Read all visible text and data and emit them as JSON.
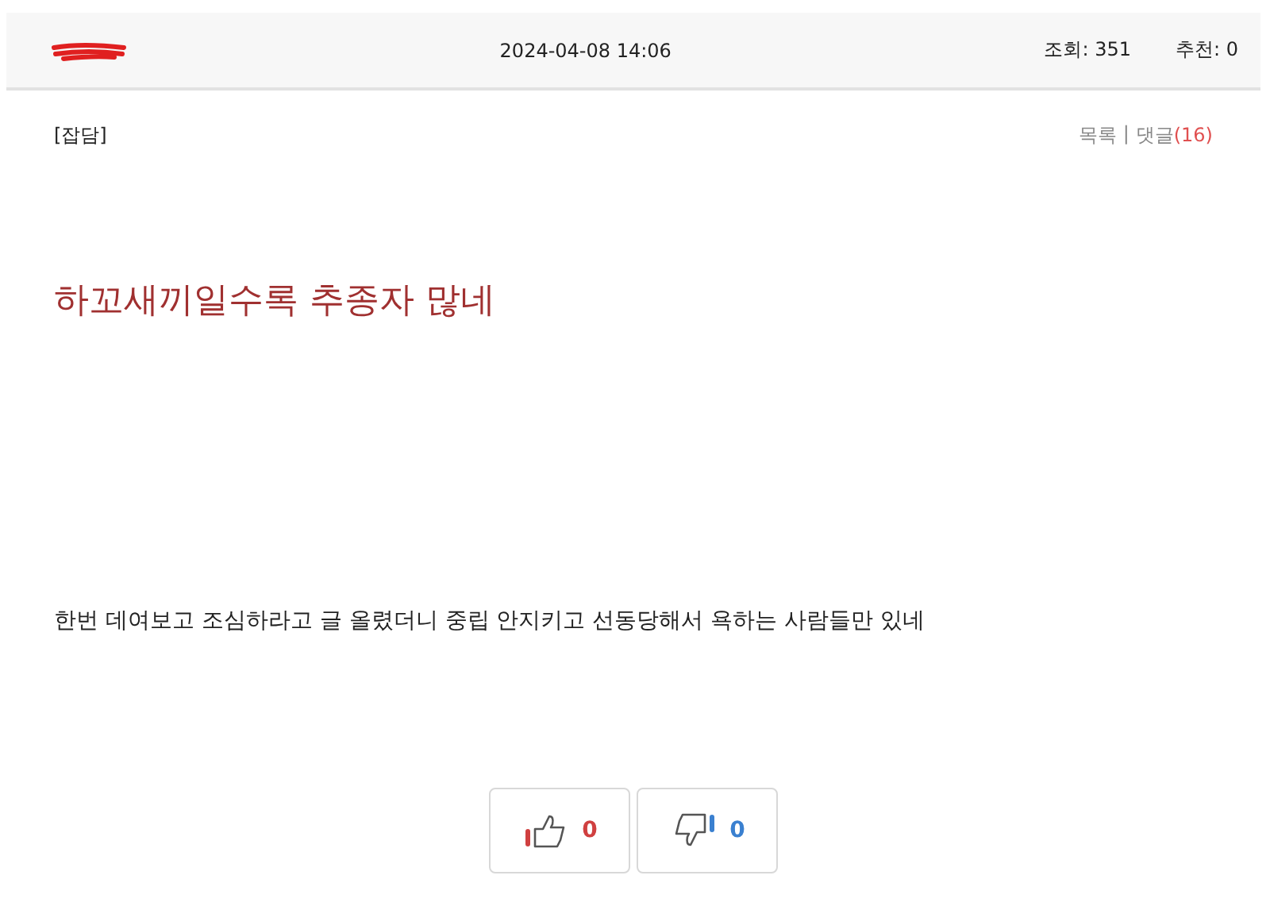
{
  "header": {
    "date": "2024-04-08 14:06",
    "views": "조회: 351",
    "recommends": "추천: 0"
  },
  "category": "[잡담]",
  "links": {
    "list": "목록",
    "separator": "|",
    "comments": "댓글",
    "comment_count": "(16)"
  },
  "title": "하꼬새끼일수록 추종자 많네",
  "body": "한번 데여보고 조심하라고 글 올렸더니 중립 안지키고 선동당해서 욕하는 사람들만 있네",
  "votes": {
    "up": "0",
    "down": "0"
  }
}
